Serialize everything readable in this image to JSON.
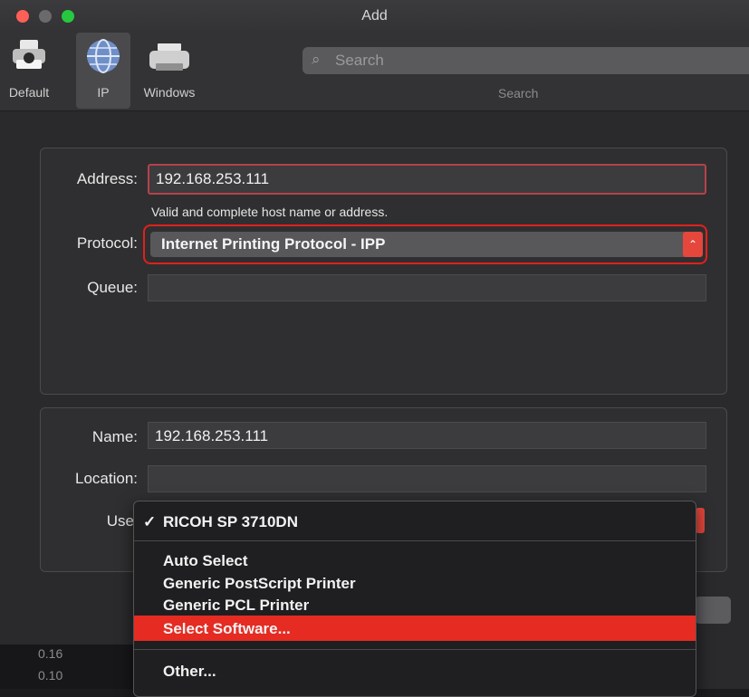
{
  "window": {
    "title": "Add"
  },
  "toolbar": {
    "items": [
      {
        "label": "Default",
        "icon": "printer-icon"
      },
      {
        "label": "IP",
        "icon": "globe-icon"
      },
      {
        "label": "Windows",
        "icon": "printer-icon"
      }
    ],
    "search_placeholder": "Search",
    "search_label": "Search"
  },
  "form": {
    "address_label": "Address:",
    "address_value": "192.168.253.111",
    "address_hint": "Valid and complete host name or address.",
    "protocol_label": "Protocol:",
    "protocol_value": "Internet Printing Protocol - IPP",
    "queue_label": "Queue:",
    "queue_value": "",
    "name_label": "Name:",
    "name_value": "192.168.253.111",
    "location_label": "Location:",
    "location_value": "",
    "use_label": "Use"
  },
  "use_menu": {
    "checked_item": "RICOH SP 3710DN",
    "items": [
      "Auto Select",
      "Generic PostScript Printer",
      "Generic PCL Printer",
      "Select Software...",
      "Other..."
    ],
    "selected_index": 3
  },
  "background_text": [
    "0.16",
    "0.10"
  ],
  "colors": {
    "accent": "#e52b22",
    "highlight_outline": "#e0211c"
  }
}
